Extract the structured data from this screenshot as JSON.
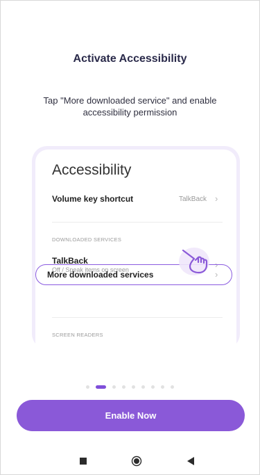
{
  "onboarding": {
    "title": "Activate Accessibility",
    "subtitle": "Tap \"More downloaded service\" and enable accessibility permission"
  },
  "settings_preview": {
    "heading": "Accessibility",
    "volume_key": {
      "label": "Volume key shortcut",
      "value": "TalkBack"
    },
    "downloaded_section": "DOWNLOADED SERVICES",
    "talkback": {
      "label": "TalkBack",
      "subtitle": "Off / Speak items on screen"
    },
    "more_services": {
      "label": "More downloaded services"
    },
    "screen_readers_section": "SCREEN READERS"
  },
  "pager": {
    "total": 9,
    "active_index": 1
  },
  "cta": {
    "label": "Enable Now"
  },
  "icons": {
    "hand": "pointing-hand-icon",
    "chevron": "chevron-right-icon",
    "nav_recents": "square-icon",
    "nav_home": "circle-icon",
    "nav_back": "triangle-back-icon"
  },
  "colors": {
    "accent": "#8A59D8",
    "accent_dark": "#7F4FD9",
    "card_halo": "#F1ECFB"
  }
}
